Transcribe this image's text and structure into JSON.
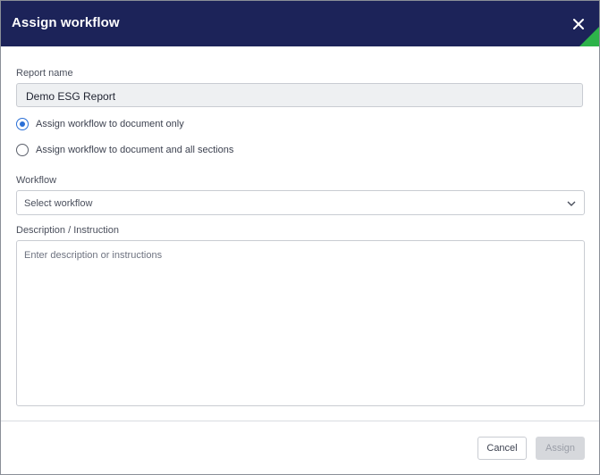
{
  "dialog": {
    "title": "Assign workflow",
    "close_icon": "close-icon"
  },
  "report": {
    "label": "Report name",
    "value": "Demo ESG Report"
  },
  "assignment_options": [
    {
      "label": "Assign workflow to document only",
      "selected": true
    },
    {
      "label": "Assign workflow to document and all sections",
      "selected": false
    }
  ],
  "workflow": {
    "label": "Workflow",
    "placeholder": "Select workflow",
    "chevron_icon": "chevron-down-icon"
  },
  "description": {
    "label": "Description / Instruction",
    "placeholder": "Enter description or instructions"
  },
  "footer": {
    "cancel_label": "Cancel",
    "assign_label": "Assign",
    "assign_disabled": true
  },
  "colors": {
    "header_bg": "#1c2359",
    "accent_corner": "#2db34a",
    "radio_selected": "#2a6fd6"
  }
}
